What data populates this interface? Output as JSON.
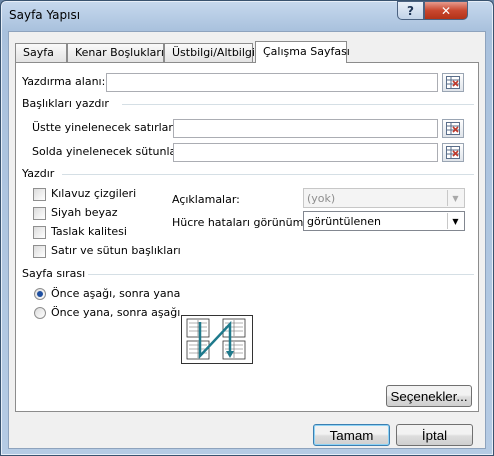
{
  "window": {
    "title": "Sayfa Yapısı",
    "help_label": "?",
    "close_label": "✕"
  },
  "tabs": [
    {
      "label": "Sayfa"
    },
    {
      "label": "Kenar Boşlukları"
    },
    {
      "label": "Üstbilgi/Altbilgi"
    },
    {
      "label": "Çalışma Sayfası"
    }
  ],
  "active_tab": "Çalışma Sayfası",
  "print_area": {
    "label": "Yazdırma alanı:",
    "value": ""
  },
  "print_titles": {
    "section_label": "Başlıkları yazdır",
    "rows_label": "Üstte yinelenecek satırlar:",
    "rows_value": "",
    "cols_label": "Solda yinelenecek sütunlar:",
    "cols_value": ""
  },
  "print": {
    "section_label": "Yazdır",
    "checkboxes": [
      {
        "label": "Kılavuz çizgileri",
        "checked": false
      },
      {
        "label": "Siyah beyaz",
        "checked": false
      },
      {
        "label": "Taslak kalitesi",
        "checked": false
      },
      {
        "label": "Satır ve sütun başlıkları",
        "checked": false
      }
    ],
    "comments_label": "Açıklamalar:",
    "comments_value": "(yok)",
    "errors_label": "Hücre hataları görünümü:",
    "errors_value": "görüntülenen"
  },
  "page_order": {
    "section_label": "Sayfa sırası",
    "options": [
      {
        "label": "Önce aşağı, sonra yana",
        "selected": true
      },
      {
        "label": "Önce yana, sonra aşağı",
        "selected": false
      }
    ]
  },
  "buttons": {
    "options": "Seçenekler...",
    "ok": "Tamam",
    "cancel": "İptal"
  },
  "icons": {
    "range_picker": "range-select-icon",
    "dropdown": "chevron-down-icon"
  },
  "colors": {
    "accent": "#1f4fa0",
    "diagram_arrow": "#1f7a8c"
  }
}
